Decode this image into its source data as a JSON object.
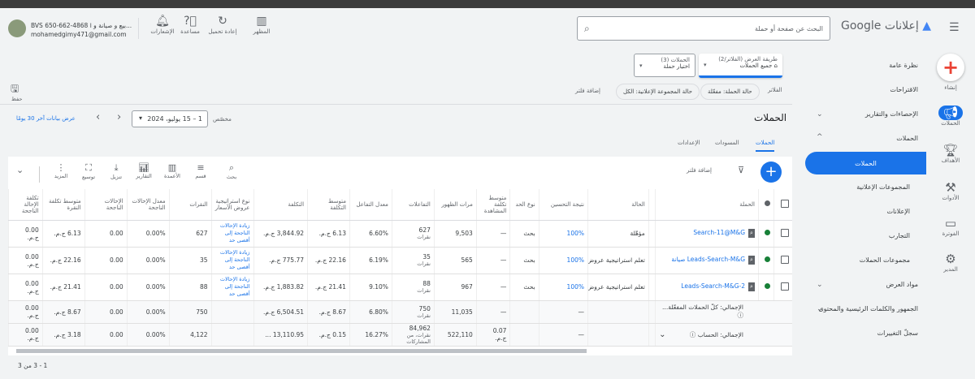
{
  "header": {
    "account_name": "BVS 650-662-4868 بيع و صيانة و ا...",
    "account_email": "mohamedgimy471@gmail.com",
    "notifications": "الإشعارات",
    "help": "مساعدة",
    "reload": "إعادة تحميل",
    "appearance": "المظهر",
    "search_placeholder": "البحث عن صفحة أو حملة",
    "logo": "إعلانات Google"
  },
  "rail": {
    "create": "إنشاء",
    "campaigns": "الحملات",
    "goals": "الأهداف",
    "tools": "الأدوات",
    "billing": "الفوترة",
    "admin": "المدير"
  },
  "nav": {
    "overview": "نظرة عامة",
    "recommendations": "الاقتراحات",
    "insights": "الإحصاءات والتقارير",
    "campaigns_group": "الحملات",
    "campaigns": "الحملات",
    "ad_groups": "المجموعات الإعلانية",
    "ads": "الإعلانات",
    "experiments": "التجارب",
    "campaign_groups": "مجموعات الحملات",
    "assets": "مواد العرض",
    "audiences": "الجمهور والكلمات الرئيسية والمحتوى",
    "change_history": "سجلّ التغييرات"
  },
  "view_selector": {
    "label": "طريقة العرض (الفلاتر/2)",
    "value": "جميع الحملات"
  },
  "campaign_selector": {
    "label": "الحملات (3)",
    "value": "اختيار حملة"
  },
  "filters": {
    "label": "الفلاتر",
    "chips": [
      "حالة الحملة: مفعّلة",
      "حالة المجموعة الإعلانية: الكل"
    ],
    "add": "إضافة فلتر"
  },
  "save": "حفظ",
  "date": {
    "custom": "مخصّص",
    "range": "1 – 15 يوليو، 2024",
    "last30": "عرض بيانات آخر 30 يومًا"
  },
  "page_title": "الحملات",
  "tabs": [
    "الحملات",
    "المسودات",
    "الإعدادات"
  ],
  "toolbar": {
    "add_filter": "إضافة فلتر",
    "search": "بحث",
    "segment": "قسم",
    "columns": "الأعمدة",
    "reports": "التقارير",
    "download": "تنزيل",
    "expand": "توسيع",
    "more": "المزيد"
  },
  "table": {
    "headers": [
      "",
      "",
      "الحملة",
      "",
      "الحالة",
      "نتيجة التحسين",
      "نوع الحد",
      "متوسط تكلفة المشاهدة",
      "مرات الظهور",
      "التفاعلات",
      "معدل التفاعل",
      "متوسط التكلفة",
      "التكلفة",
      "نوع استراتيجية عروض الأسعار",
      "النقرات",
      "معدل الإحالات الناجحة",
      "الإحالات الناجحة",
      "متوسط تكلفة النقرة",
      "تكلفة الإحالة الناجحة"
    ],
    "rows": [
      {
        "name": "Search-11@M&G",
        "status": "مؤهّلة",
        "score": "100%",
        "bid": "بحث",
        "cpv": "—",
        "impr": "9,503",
        "inter": "627",
        "inter_unit": "نقرات",
        "rate": "6.60%",
        "avg": "6.13 ج.م.",
        "cost": "3,844.92 ج.م.",
        "strategy": "زيادة الإحالات الناجحة إلى أقصى حد",
        "clicks": "627",
        "conv_rate": "0.00%",
        "conv": "0.00",
        "cpc": "6.13 ج.م.",
        "cpa": "0.00 ج.م."
      },
      {
        "name": "Leads-Search-M&G صيانة",
        "status": "تعلم استراتيجية عروض",
        "score": "100%",
        "bid": "بحث",
        "cpv": "—",
        "impr": "565",
        "inter": "35",
        "inter_unit": "نقرات",
        "rate": "6.19%",
        "avg": "22.16 ج.م.",
        "cost": "775.77 ج.م.",
        "strategy": "زيادة الإحالات الناجحة إلى أقصى حد",
        "clicks": "35",
        "conv_rate": "0.00%",
        "conv": "0.00",
        "cpc": "22.16 ج.م.",
        "cpa": "0.00 ج.م."
      },
      {
        "name": "Leads-Search-M&G-2",
        "status": "تعلم استراتيجية عروض",
        "score": "100%",
        "bid": "بحث",
        "cpv": "—",
        "impr": "967",
        "inter": "88",
        "inter_unit": "نقرات",
        "rate": "9.10%",
        "avg": "21.41 ج.م.",
        "cost": "1,883.82 ج.م.",
        "strategy": "زيادة الإحالات الناجحة إلى أقصى حد",
        "clicks": "88",
        "conv_rate": "0.00%",
        "conv": "0.00",
        "cpc": "21.41 ج.م.",
        "cpa": "0.00 ج.م."
      }
    ],
    "totals": [
      {
        "name": "الإجمالي: كلّ الحملات المفعّلة...",
        "status": "",
        "score": "—",
        "bid": "",
        "cpv": "—",
        "impr": "11,035",
        "inter": "750",
        "inter_unit": "نقرات",
        "rate": "6.80%",
        "avg": "8.67 ج.م.",
        "cost": "6,504.51 ج.م.",
        "strategy": "",
        "clicks": "750",
        "conv_rate": "0.00%",
        "conv": "0.00",
        "cpc": "8.67 ج.م.",
        "cpa": "0.00 ج.م."
      },
      {
        "name": "الإجمالي: الحساب",
        "status": "",
        "score": "—",
        "bid": "",
        "cpv": "0.07 ج.م.",
        "impr": "522,110",
        "inter": "84,962",
        "inter_unit": "نقرات، من المشاركات",
        "rate": "16.27%",
        "avg": "0.15 ج.م.",
        "cost": "13,110.95 ...",
        "strategy": "",
        "clicks": "4,122",
        "conv_rate": "0.00%",
        "conv": "0.00",
        "cpc": "3.18 ج.م.",
        "cpa": "0.00 ج.م."
      }
    ],
    "pagination": "1 - 3 من 3"
  }
}
